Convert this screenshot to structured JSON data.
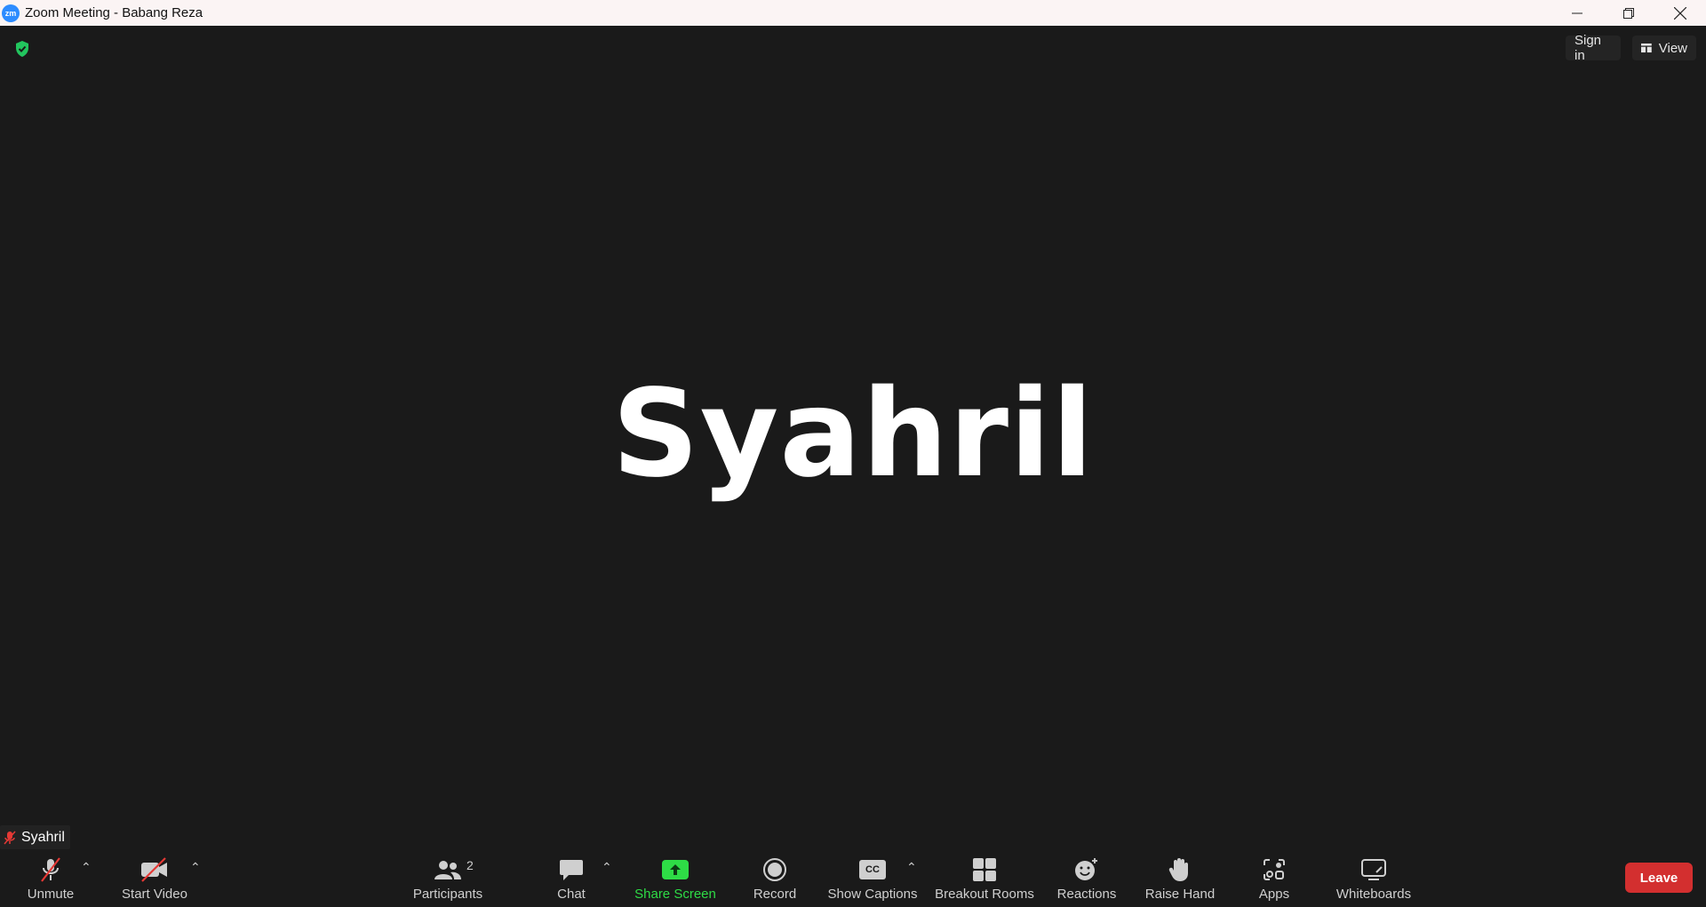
{
  "window": {
    "title": "Zoom Meeting - Babang Reza",
    "app_icon_text": "zm"
  },
  "topbar": {
    "sign_in": "Sign in",
    "view": "View"
  },
  "participant": {
    "display_name": "Syahril",
    "name_tag": "Syahril"
  },
  "toolbar": {
    "unmute": "Unmute",
    "start_video": "Start Video",
    "participants": "Participants",
    "participants_count": "2",
    "chat": "Chat",
    "share_screen": "Share Screen",
    "record": "Record",
    "show_captions": "Show Captions",
    "captions_icon_text": "CC",
    "breakout_rooms": "Breakout Rooms",
    "reactions": "Reactions",
    "raise_hand": "Raise Hand",
    "apps": "Apps",
    "whiteboards": "Whiteboards",
    "leave": "Leave"
  },
  "colors": {
    "background": "#1a1a1a",
    "accent_green": "#2edc46",
    "leave_red": "#d32f2f",
    "brand_blue": "#2d8cff"
  }
}
